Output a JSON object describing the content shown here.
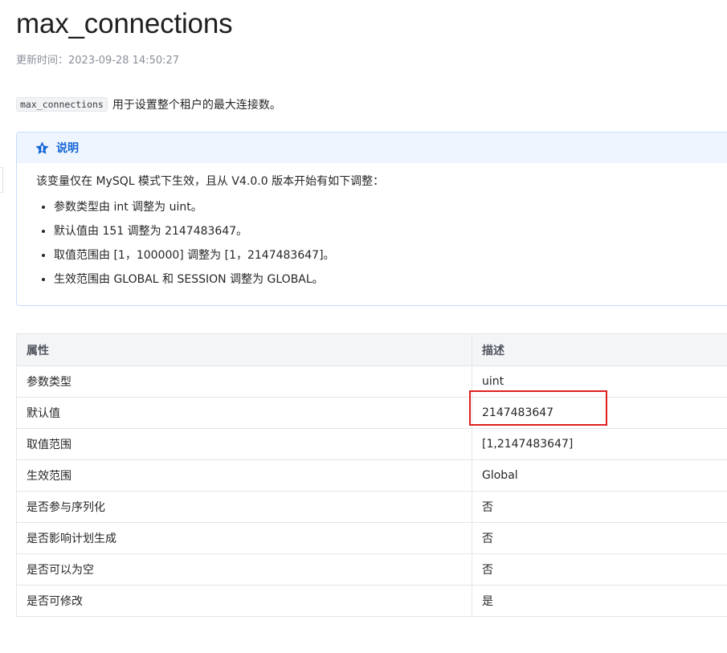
{
  "title": "max_connections",
  "updated": "更新时间：2023-09-28 14:50:27",
  "intro": {
    "code": "max_connections",
    "text": "用于设置整个租户的最大连接数。"
  },
  "note": {
    "heading": "说明",
    "icon": "star-icon",
    "accent_color": "#1466d8",
    "intro": "该变量仅在 MySQL 模式下生效，且从 V4.0.0 版本开始有如下调整：",
    "items": [
      "参数类型由 int 调整为 uint。",
      "默认值由 151 调整为 2147483647。",
      "取值范围由 [1，100000] 调整为 [1，2147483647]。",
      "生效范围由 GLOBAL 和 SESSION 调整为 GLOBAL。"
    ]
  },
  "table": {
    "headers": [
      "属性",
      "描述"
    ],
    "rows": [
      [
        "参数类型",
        "uint"
      ],
      [
        "默认值",
        "2147483647"
      ],
      [
        "取值范围",
        "[1,2147483647]"
      ],
      [
        "生效范围",
        "Global"
      ],
      [
        "是否参与序列化",
        "否"
      ],
      [
        "是否影响计划生成",
        "否"
      ],
      [
        "是否可以为空",
        "否"
      ],
      [
        "是否可修改",
        "是"
      ]
    ]
  },
  "highlight_color": "#e02020"
}
